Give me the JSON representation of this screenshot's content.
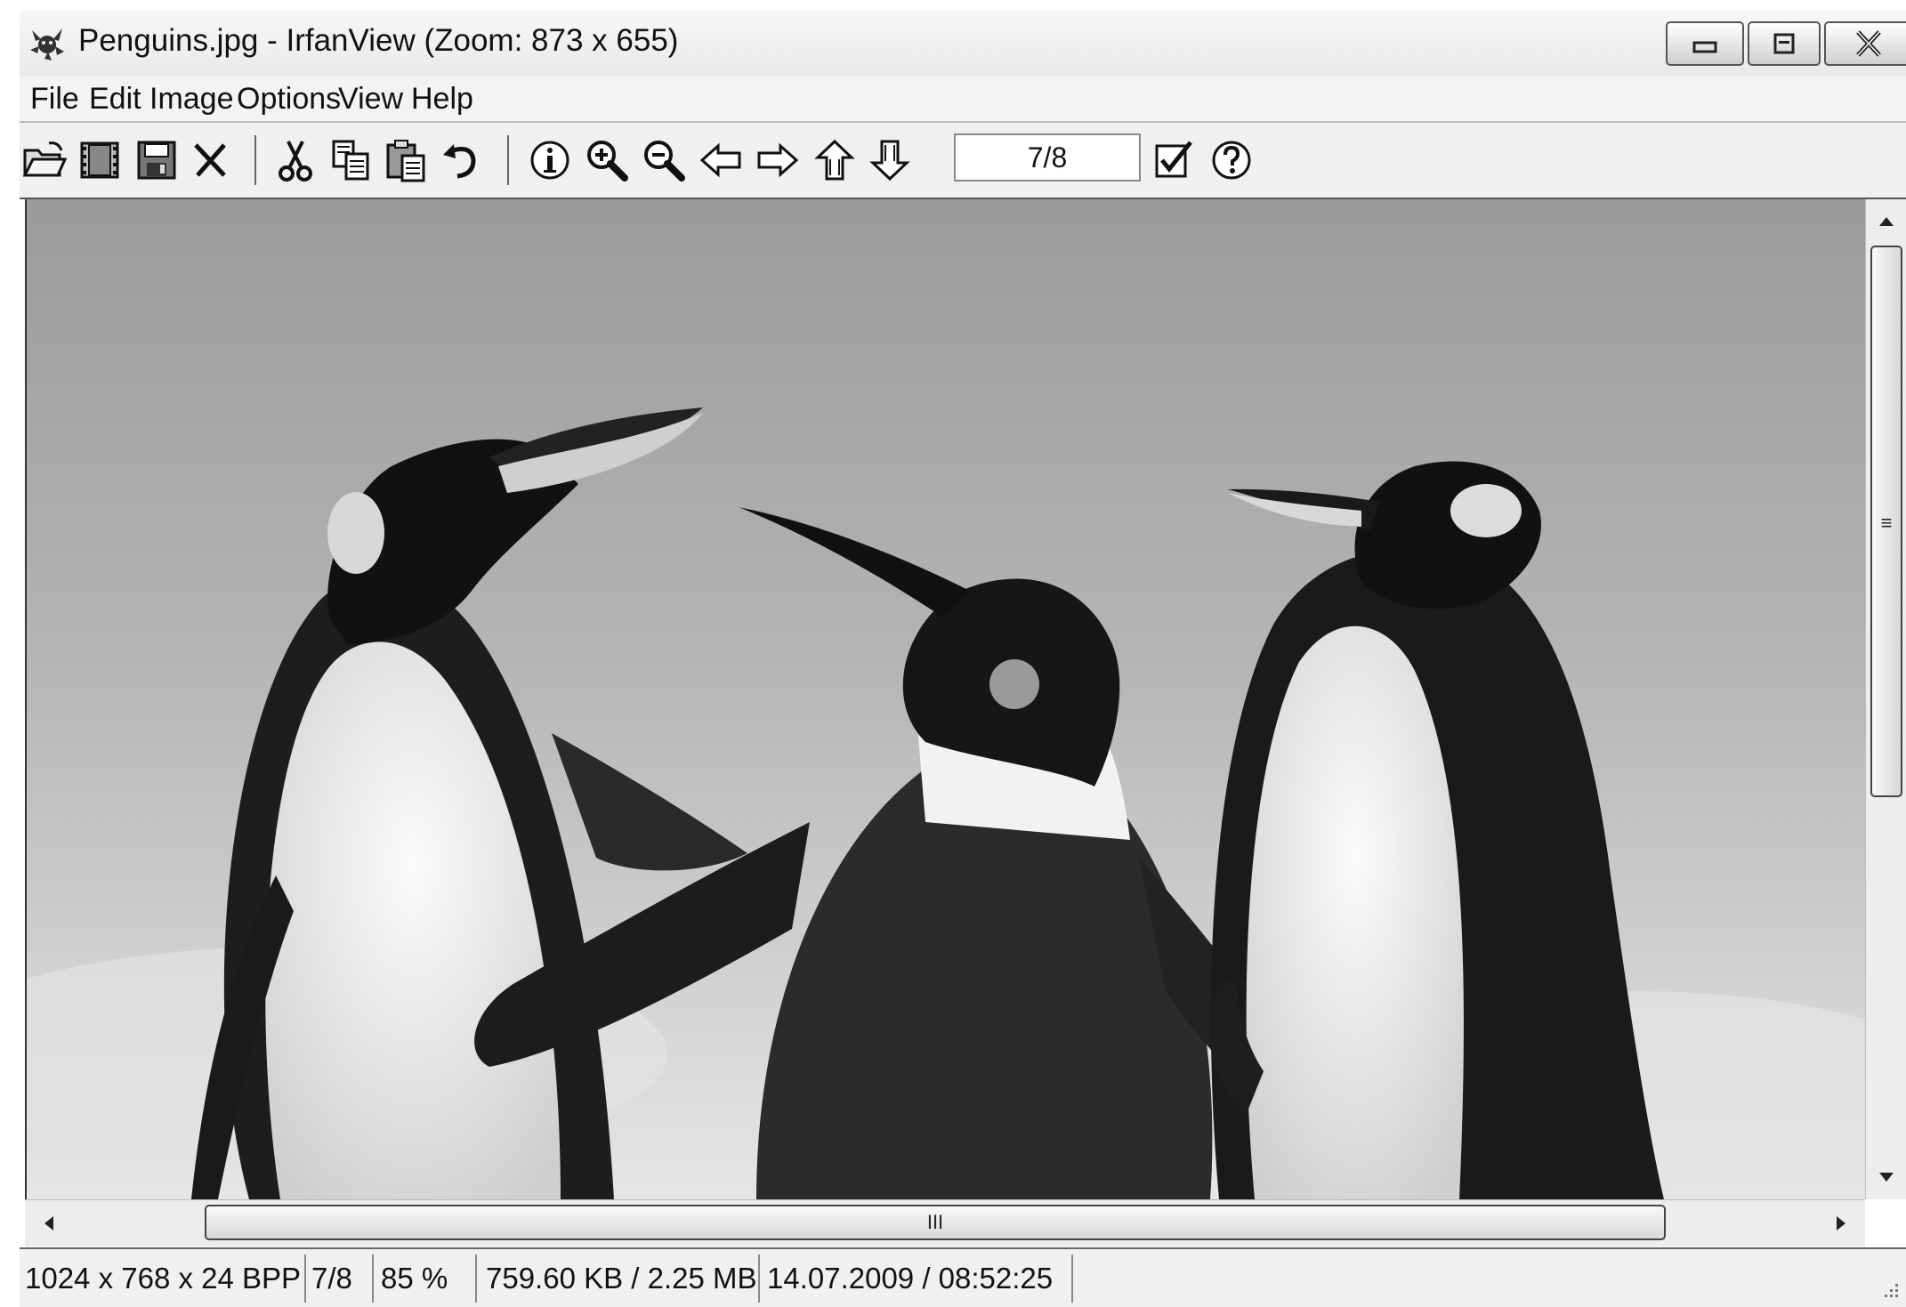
{
  "window": {
    "title": "Penguins.jpg - IrfanView (Zoom: 873 x 655)",
    "app_icon": "irfanview-cat-icon",
    "controls": {
      "minimize": "minimize-icon",
      "maximize": "maximize-icon",
      "close": "close-icon"
    }
  },
  "menu": [
    "File",
    "Edit",
    "Image",
    "Options",
    "View",
    "Help"
  ],
  "toolbar": {
    "icons": [
      "open-folder-icon",
      "slideshow-icon",
      "save-icon",
      "delete-icon",
      "cut-icon",
      "copy-icon",
      "paste-icon",
      "undo-icon",
      "info-icon",
      "zoom-in-icon",
      "zoom-out-icon",
      "previous-arrow-icon",
      "next-arrow-icon",
      "first-file-icon",
      "last-file-icon",
      "properties-checkbox-icon",
      "help-icon"
    ],
    "page_indicator": "7/8"
  },
  "scrollbars": {
    "vertical_grip": "≡",
    "horizontal_grip": "III"
  },
  "status": {
    "dimensions": "1024 x 768 x 24 BPP",
    "index": "7/8",
    "zoom": "85 %",
    "size": "759.60 KB / 2.25 MB",
    "datetime": "14.07.2009 / 08:52:25"
  },
  "colors": {
    "frame": "#f0f0f0",
    "border": "#555555"
  }
}
